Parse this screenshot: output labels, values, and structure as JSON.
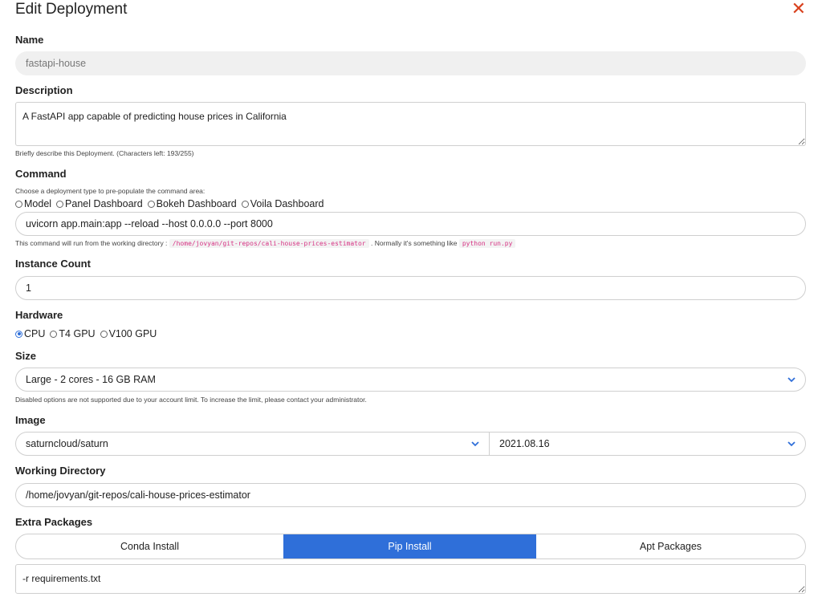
{
  "modal": {
    "title": "Edit Deployment",
    "close_glyph": "✕"
  },
  "name": {
    "label": "Name",
    "value": "fastapi-house"
  },
  "description": {
    "label": "Description",
    "value": "A FastAPI app capable of predicting house prices in California",
    "help": "Briefly describe this Deployment. (Characters left: 193/255)"
  },
  "command": {
    "label": "Command",
    "help": "Choose a deployment type to pre-populate the command area:",
    "types": [
      "Model",
      "Panel Dashboard",
      "Bokeh Dashboard",
      "Voila Dashboard"
    ],
    "value": "uvicorn app.main:app --reload --host 0.0.0.0 --port 8000",
    "note_prefix": "This command will run from the working directory :",
    "note_dir": "/home/jovyan/git-repos/cali-house-prices-estimator",
    "note_middle": ". Normally it's something like",
    "note_example": "python run.py"
  },
  "instance_count": {
    "label": "Instance Count",
    "value": "1"
  },
  "hardware": {
    "label": "Hardware",
    "options": [
      "CPU",
      "T4 GPU",
      "V100 GPU"
    ],
    "selected": "CPU"
  },
  "size": {
    "label": "Size",
    "value": "Large - 2 cores - 16 GB RAM",
    "help": "Disabled options are not supported due to your account limit. To increase the limit, please contact your administrator."
  },
  "image": {
    "label": "Image",
    "name": "saturncloud/saturn",
    "version": "2021.08.16"
  },
  "working_directory": {
    "label": "Working Directory",
    "value": "/home/jovyan/git-repos/cali-house-prices-estimator"
  },
  "extra_packages": {
    "label": "Extra Packages",
    "tabs": [
      "Conda Install",
      "Pip Install",
      "Apt Packages"
    ],
    "active_tab": "Pip Install",
    "value": "-r requirements.txt"
  },
  "colors": {
    "accent": "#2f6fd9",
    "close": "#d9411e",
    "code": "#d63384"
  }
}
